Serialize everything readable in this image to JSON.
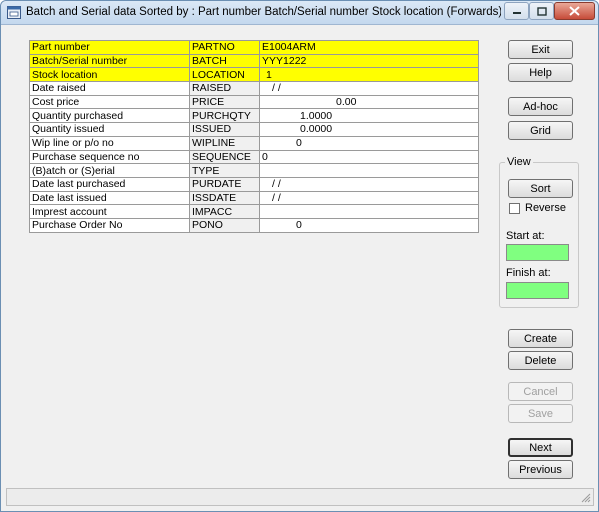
{
  "window": {
    "title": "Batch and Serial data Sorted by : Part number Batch/Serial number Stock location (Forwards) - UD Truck..."
  },
  "rows": [
    {
      "label": "Part number",
      "field": "PARTNO",
      "value": "E1004ARM",
      "highlight": true
    },
    {
      "label": "Batch/Serial number",
      "field": "BATCH",
      "value": "YYY1222",
      "highlight": true
    },
    {
      "label": "Stock location",
      "field": "LOCATION",
      "value": "1",
      "highlight": true
    },
    {
      "label": "Date raised",
      "field": "RAISED",
      "value": "/    /"
    },
    {
      "label": "Cost price",
      "field": "PRICE",
      "value": "0.00"
    },
    {
      "label": "Quantity purchased",
      "field": "PURCHQTY",
      "value": "1.0000"
    },
    {
      "label": "Quantity issued",
      "field": "ISSUED",
      "value": "0.0000"
    },
    {
      "label": "Wip line or p/o no",
      "field": "WIPLINE",
      "value": "0"
    },
    {
      "label": "Purchase sequence no",
      "field": "SEQUENCE",
      "value": "0"
    },
    {
      "label": "(B)atch or (S)erial",
      "field": "TYPE",
      "value": ""
    },
    {
      "label": "Date last purchased",
      "field": "PURDATE",
      "value": "/    /"
    },
    {
      "label": "Date last issued",
      "field": "ISSDATE",
      "value": "/    /"
    },
    {
      "label": "Imprest account",
      "field": "IMPACC",
      "value": ""
    },
    {
      "label": "Purchase Order No",
      "field": "PONO",
      "value": "0"
    }
  ],
  "buttons": {
    "exit": "Exit",
    "help": "Help",
    "adhoc": "Ad-hoc",
    "grid": "Grid",
    "sort": "Sort",
    "create": "Create",
    "delete": "Delete",
    "cancel": "Cancel",
    "save": "Save",
    "next": "Next",
    "previous": "Previous"
  },
  "view": {
    "legend": "View",
    "reverse_label": "Reverse",
    "reverse_checked": false,
    "start_label": "Start at:",
    "start_value": "",
    "finish_label": "Finish at:",
    "finish_value": ""
  },
  "colors": {
    "highlight": "#ffff00",
    "input_green": "#80ff80"
  }
}
